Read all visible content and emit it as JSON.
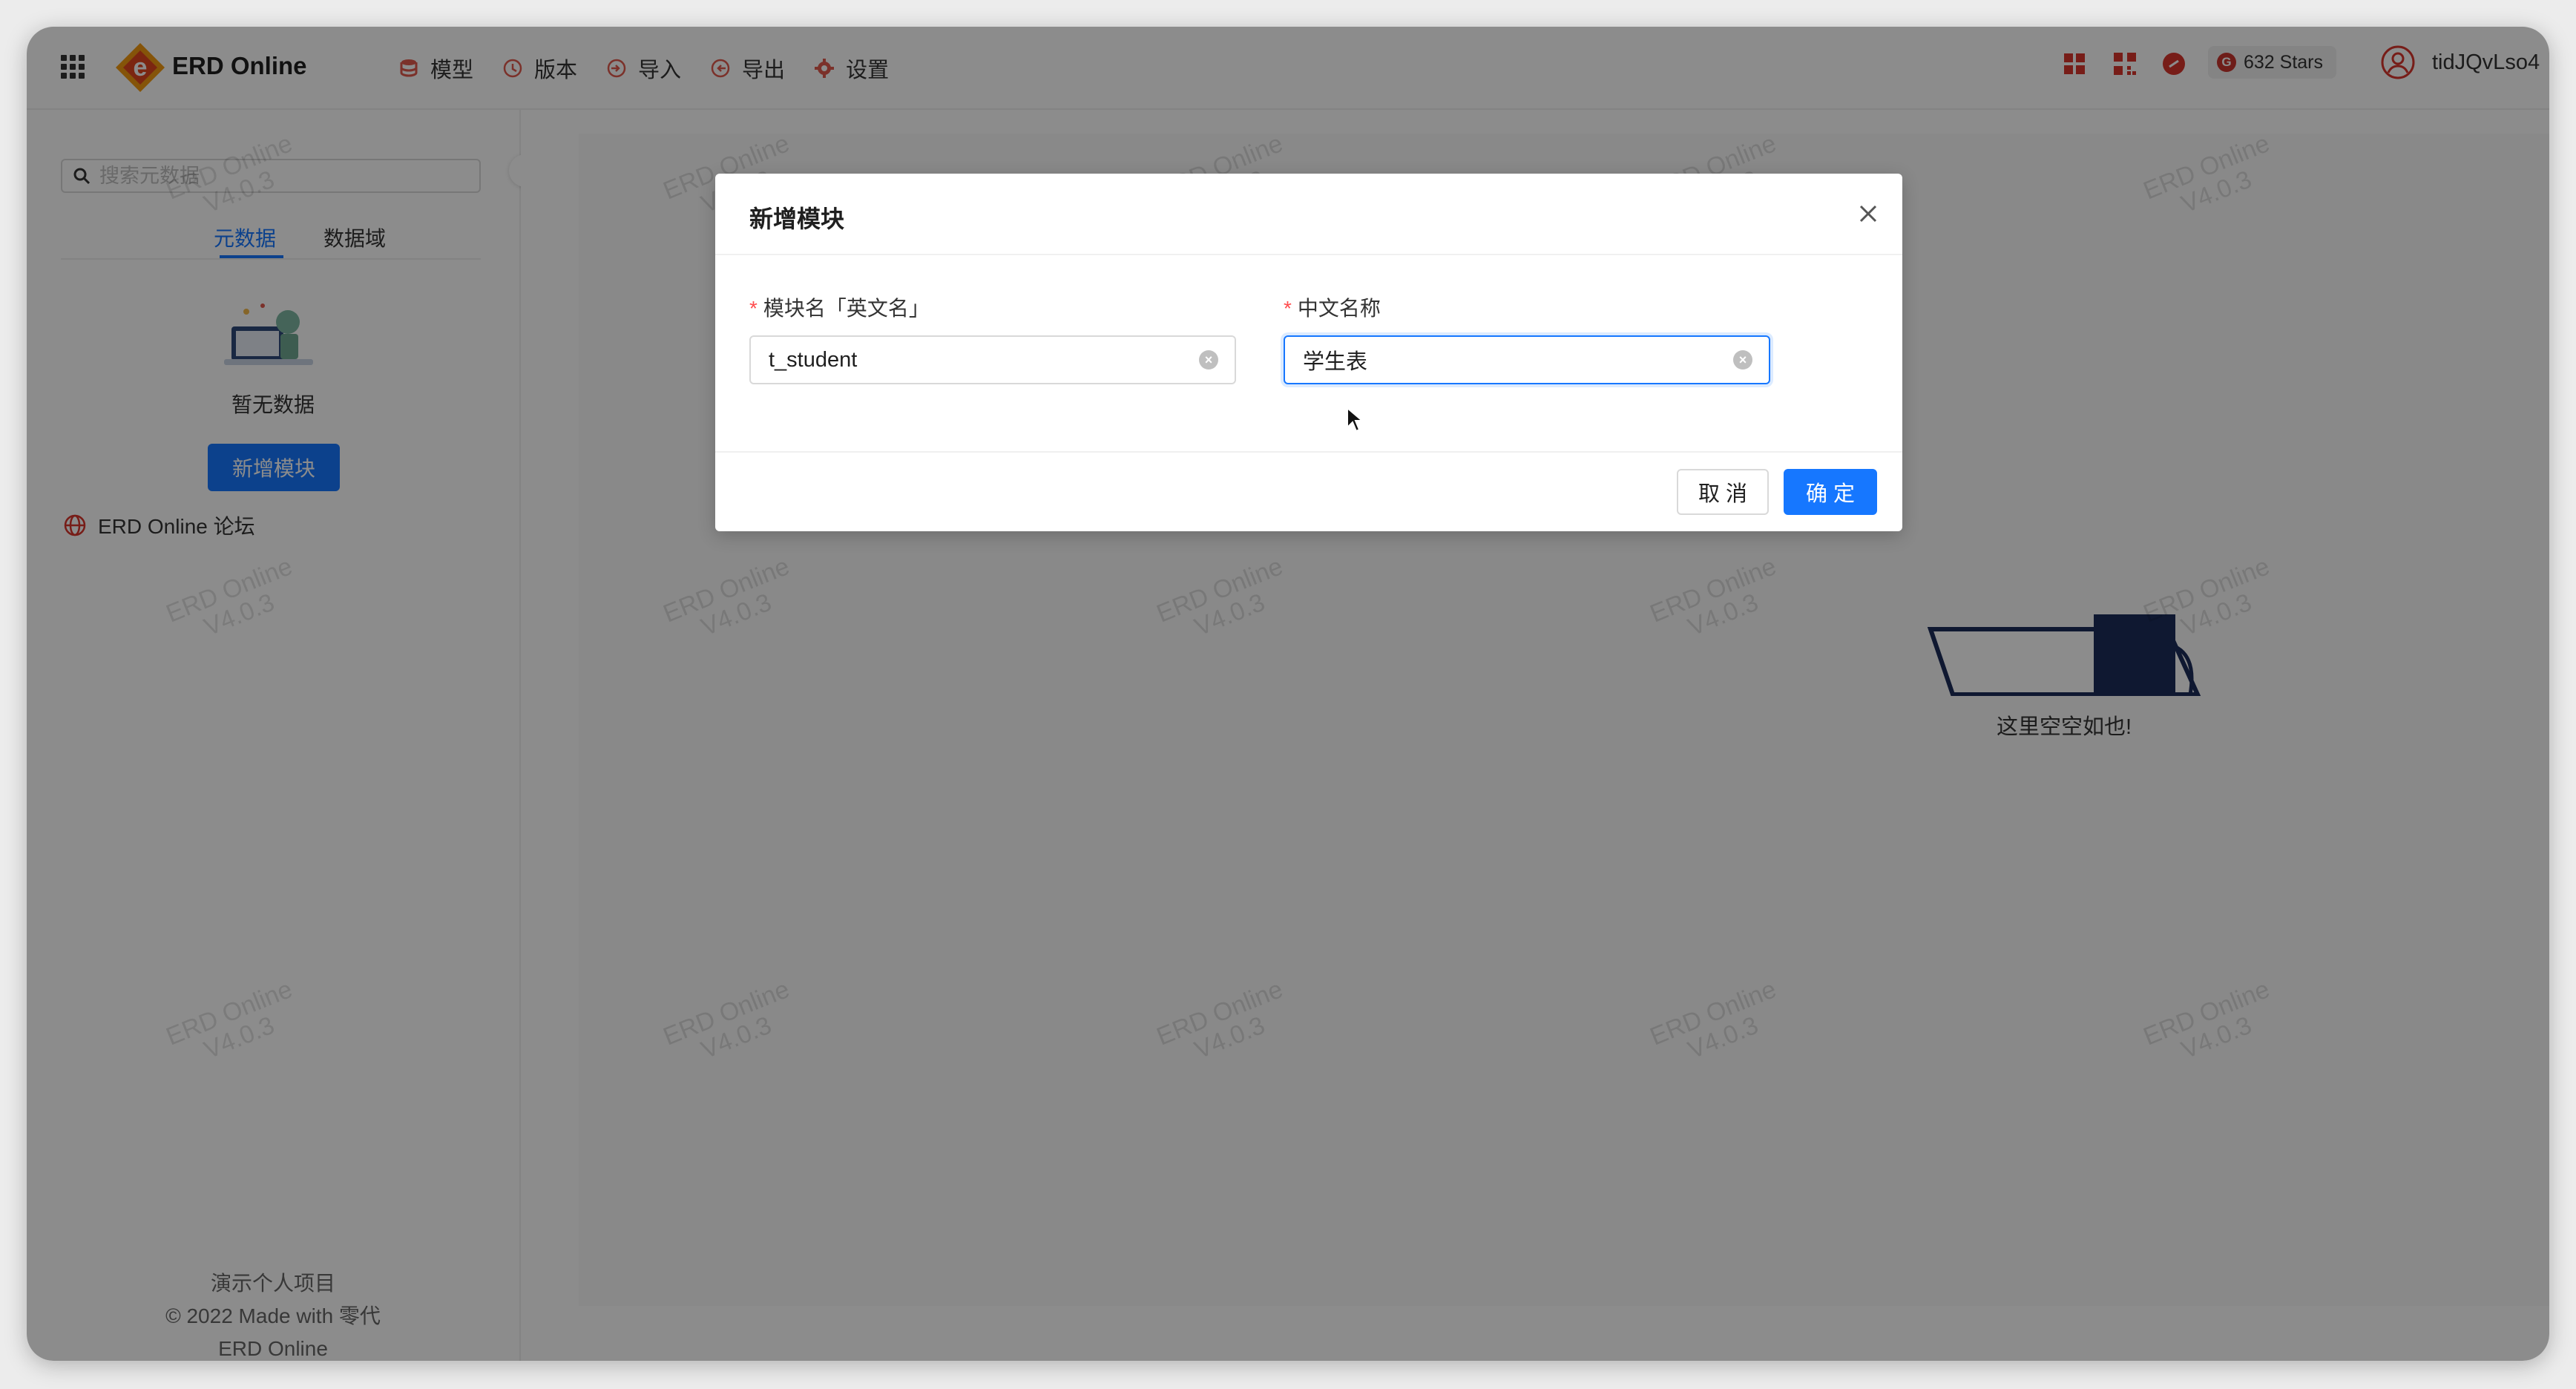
{
  "app": {
    "title": "ERD Online"
  },
  "nav": [
    {
      "label": "模型",
      "icon": "database-icon"
    },
    {
      "label": "版本",
      "icon": "history-icon"
    },
    {
      "label": "导入",
      "icon": "import-icon"
    },
    {
      "label": "导出",
      "icon": "export-icon"
    },
    {
      "label": "设置",
      "icon": "gear-icon"
    }
  ],
  "header_right": {
    "stars": "632 Stars",
    "username": "tidJQvLso4"
  },
  "sidebar": {
    "search_placeholder": "搜索元数据",
    "tabs": [
      "元数据",
      "数据域"
    ],
    "active_tab": "元数据",
    "empty_text": "暂无数据",
    "add_button": "新增模块",
    "forum_link": "ERD Online 论坛",
    "footer": [
      "演示个人项目",
      "© 2022 Made with 零代",
      "ERD Online"
    ]
  },
  "main": {
    "empty_text": "这里空空如也!"
  },
  "watermark": {
    "line1": "ERD Online",
    "line2": "V4.0.3"
  },
  "modal": {
    "title": "新增模块",
    "fields": [
      {
        "label": "模块名「英文名」",
        "value": "t_student",
        "required": true
      },
      {
        "label": "中文名称",
        "value": "学生表",
        "required": true
      }
    ],
    "cancel": "取 消",
    "ok": "确 定"
  },
  "colors": {
    "primary": "#1677ff",
    "required": "#ff4d4f",
    "brand": "#f29a12"
  }
}
